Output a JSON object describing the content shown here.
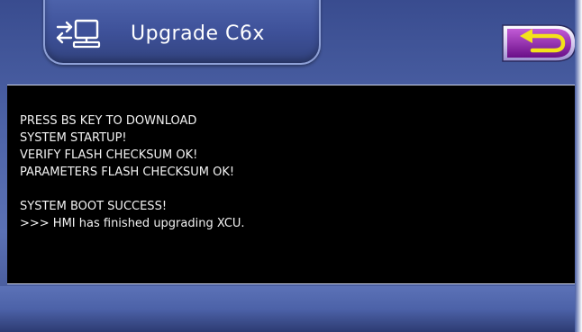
{
  "header": {
    "title": "Upgrade C6x",
    "tab_icon": "transfer-computer-icon",
    "back_icon": "return-arrow-icon"
  },
  "console": {
    "lines": [
      "PRESS BS KEY TO DOWNLOAD",
      "SYSTEM STARTUP!",
      "VERIFY FLASH CHECKSUM OK!",
      "PARAMETERS FLASH CHECKSUM OK!",
      "",
      "SYSTEM BOOT SUCCESS!",
      ">>> HMI has finished upgrading XCU."
    ]
  },
  "colors": {
    "background": "#4e64a8",
    "console_bg": "#000000",
    "console_text": "#f2f2f2",
    "back_button_fill": "#8b1fa6",
    "back_arrow": "#f4e21a"
  }
}
